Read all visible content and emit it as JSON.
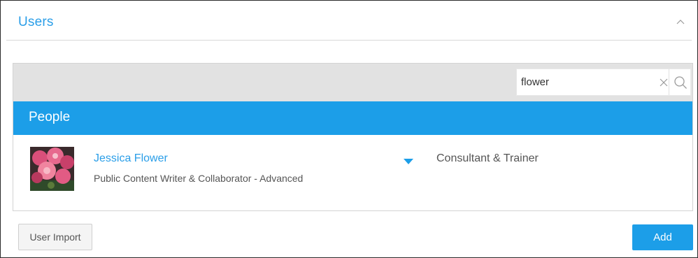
{
  "panel": {
    "title": "Users",
    "collapse_icon": "chevron-up-icon"
  },
  "search": {
    "value": "flower",
    "placeholder": "",
    "clear_icon": "close-icon",
    "search_icon": "search-icon"
  },
  "section": {
    "title": "People"
  },
  "users": [
    {
      "name": "Jessica Flower",
      "role": "Public Content Writer & Collaborator - Advanced",
      "title": "Consultant & Trainer",
      "avatar_icon": "flower-photo-avatar",
      "dropdown_icon": "caret-down-icon"
    }
  ],
  "footer": {
    "import_label": "User Import",
    "add_label": "Add"
  },
  "colors": {
    "accent": "#1c9ee8",
    "link": "#2a9ee8",
    "toolbar_bg": "#e2e2e2"
  }
}
